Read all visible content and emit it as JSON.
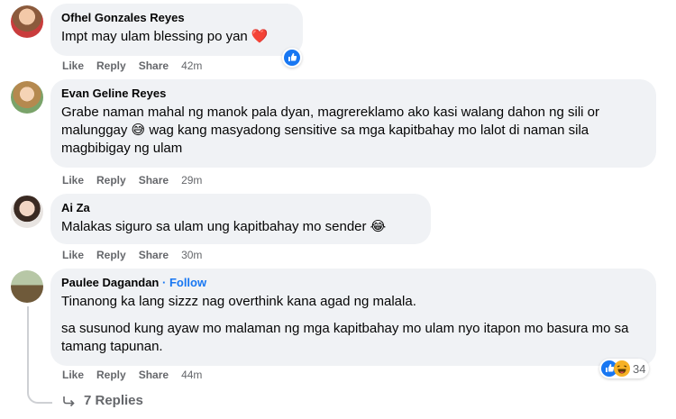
{
  "comments": [
    {
      "author": "Ofhel Gonzales Reyes",
      "follow": "",
      "text": [
        "Impt may ulam blessing po yan ❤️"
      ],
      "actions": {
        "like": "Like",
        "reply": "Reply",
        "share": "Share",
        "time": "42m"
      }
    },
    {
      "author": "Evan Geline Reyes",
      "follow": "",
      "text": [
        "Grabe naman mahal ng manok pala dyan, magrereklamo ako kasi walang dahon ng sili or malunggay 😅 wag kang masyadong sensitive sa mga kapitbahay mo lalot di naman sila magbibigay ng ulam"
      ],
      "actions": {
        "like": "Like",
        "reply": "Reply",
        "share": "Share",
        "time": "29m"
      }
    },
    {
      "author": "Ai Za",
      "follow": "",
      "text": [
        "Malakas siguro sa ulam ung kapitbahay mo sender 😂"
      ],
      "actions": {
        "like": "Like",
        "reply": "Reply",
        "share": "Share",
        "time": "30m"
      }
    },
    {
      "author": "Paulee Dagandan",
      "follow": "· Follow",
      "text": [
        "Tinanong ka lang sizzz nag overthink kana agad ng malala.",
        "sa susunod kung ayaw mo malaman ng mga kapitbahay mo ulam nyo itapon mo basura mo sa tamang tapunan."
      ],
      "actions": {
        "like": "Like",
        "reply": "Reply",
        "share": "Share",
        "time": "44m"
      },
      "reaction_count": "34"
    }
  ],
  "replies_label": "7 Replies",
  "colors": {
    "like_blue": "#1877f2",
    "haha_yellow": "#f7b125",
    "bubble": "#f0f2f5",
    "meta_gray": "#65676b"
  },
  "icons": [
    "like-reaction-icon",
    "haha-reaction-icon",
    "reply-arrow-icon",
    "heart-emoji",
    "sweat-smile-emoji",
    "joy-emoji"
  ]
}
